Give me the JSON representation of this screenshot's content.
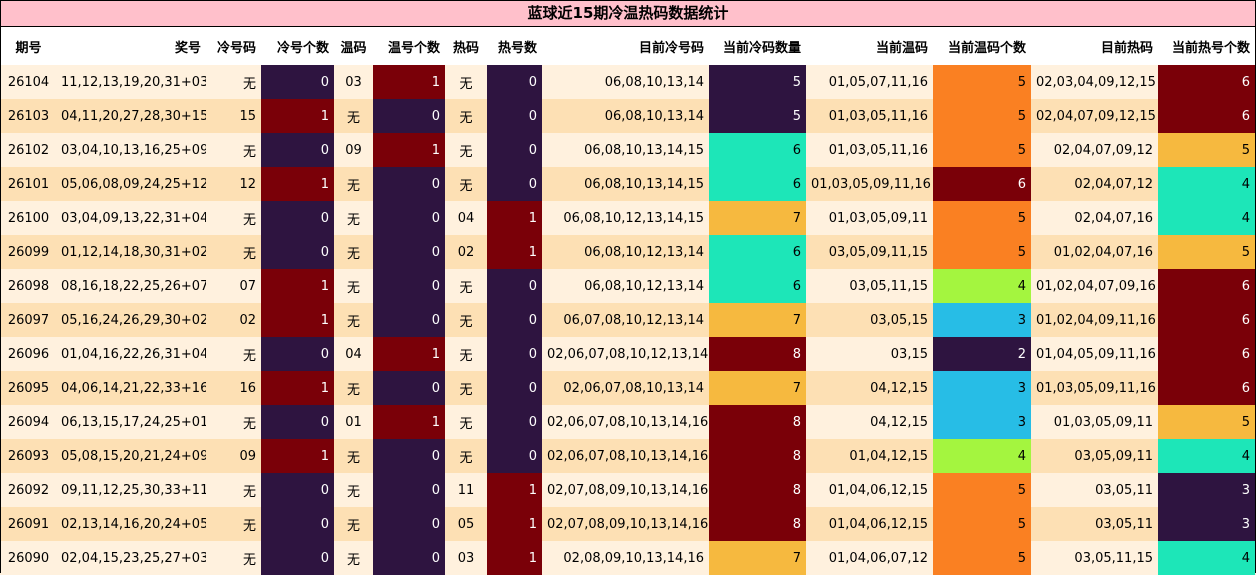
{
  "title": "蓝球近15期冷温热码数据统计",
  "columns": [
    "期号",
    "奖号",
    "冷号码",
    "冷号个数",
    "温码",
    "温号个数",
    "热码",
    "热号数",
    "目前冷号码",
    "当前冷码数量",
    "当前温码",
    "当前温码个数",
    "目前热码",
    "当前热号个数"
  ],
  "rows": [
    [
      "26104",
      "11,12,13,19,20,31+03",
      "无",
      "0",
      "03",
      "1",
      "无",
      "0",
      "06,08,10,13,14",
      "5",
      "01,05,07,11,16",
      "5",
      "02,03,04,09,12,15",
      "6"
    ],
    [
      "26103",
      "04,11,20,27,28,30+15",
      "15",
      "1",
      "无",
      "0",
      "无",
      "0",
      "06,08,10,13,14",
      "5",
      "01,03,05,11,16",
      "5",
      "02,04,07,09,12,15",
      "6"
    ],
    [
      "26102",
      "03,04,10,13,16,25+09",
      "无",
      "0",
      "09",
      "1",
      "无",
      "0",
      "06,08,10,13,14,15",
      "6",
      "01,03,05,11,16",
      "5",
      "02,04,07,09,12",
      "5"
    ],
    [
      "26101",
      "05,06,08,09,24,25+12",
      "12",
      "1",
      "无",
      "0",
      "无",
      "0",
      "06,08,10,13,14,15",
      "6",
      "01,03,05,09,11,16",
      "6",
      "02,04,07,12",
      "4"
    ],
    [
      "26100",
      "03,04,09,13,22,31+04",
      "无",
      "0",
      "无",
      "0",
      "04",
      "1",
      "06,08,10,12,13,14,15",
      "7",
      "01,03,05,09,11",
      "5",
      "02,04,07,16",
      "4"
    ],
    [
      "26099",
      "01,12,14,18,30,31+02",
      "无",
      "0",
      "无",
      "0",
      "02",
      "1",
      "06,08,10,12,13,14",
      "6",
      "03,05,09,11,15",
      "5",
      "01,02,04,07,16",
      "5"
    ],
    [
      "26098",
      "08,16,18,22,25,26+07",
      "07",
      "1",
      "无",
      "0",
      "无",
      "0",
      "06,08,10,12,13,14",
      "6",
      "03,05,11,15",
      "4",
      "01,02,04,07,09,16",
      "6"
    ],
    [
      "26097",
      "05,16,24,26,29,30+02",
      "02",
      "1",
      "无",
      "0",
      "无",
      "0",
      "06,07,08,10,12,13,14",
      "7",
      "03,05,15",
      "3",
      "01,02,04,09,11,16",
      "6"
    ],
    [
      "26096",
      "01,04,16,22,26,31+04",
      "无",
      "0",
      "04",
      "1",
      "无",
      "0",
      "02,06,07,08,10,12,13,14",
      "8",
      "03,15",
      "2",
      "01,04,05,09,11,16",
      "6"
    ],
    [
      "26095",
      "04,06,14,21,22,33+16",
      "16",
      "1",
      "无",
      "0",
      "无",
      "0",
      "02,06,07,08,10,13,14",
      "7",
      "04,12,15",
      "3",
      "01,03,05,09,11,16",
      "6"
    ],
    [
      "26094",
      "06,13,15,17,24,25+01",
      "无",
      "0",
      "01",
      "1",
      "无",
      "0",
      "02,06,07,08,10,13,14,16",
      "8",
      "04,12,15",
      "3",
      "01,03,05,09,11",
      "5"
    ],
    [
      "26093",
      "05,08,15,20,21,24+09",
      "09",
      "1",
      "无",
      "0",
      "无",
      "0",
      "02,06,07,08,10,13,14,16",
      "8",
      "01,04,12,15",
      "4",
      "03,05,09,11",
      "4"
    ],
    [
      "26092",
      "09,11,12,25,30,33+11",
      "无",
      "0",
      "无",
      "0",
      "11",
      "1",
      "02,07,08,09,10,13,14,16",
      "8",
      "01,04,06,12,15",
      "5",
      "03,05,11",
      "3"
    ],
    [
      "26091",
      "02,13,14,16,20,24+05",
      "无",
      "0",
      "无",
      "0",
      "05",
      "1",
      "02,07,08,09,10,13,14,16",
      "8",
      "01,04,06,12,15",
      "5",
      "03,05,11",
      "3"
    ],
    [
      "26090",
      "02,04,15,23,25,27+03",
      "无",
      "0",
      "无",
      "0",
      "03",
      "1",
      "02,08,09,10,13,14,16",
      "7",
      "01,04,06,07,12",
      "5",
      "03,05,11,15",
      "4"
    ]
  ],
  "colors": {
    "title_bg": "#ffc0cb",
    "header_bg": "#ffffff",
    "row_odd_bg": "#fff1de",
    "row_even_bg": "#fde0b4",
    "count_0": "#2e1440",
    "count_1": "#7a0008",
    "count_2": "#2e1440",
    "count_3": "#27bde6",
    "count_4": "#a4f53f",
    "count_5": "#fa8022",
    "count_6": "#1de6b8",
    "count_7": "#f6b93f",
    "count_8": "#7a0008",
    "cur_hot_3": "#2e1440",
    "cur_hot_4": "#1de6b8",
    "cur_hot_5": "#f6b93f",
    "cur_hot_6": "#7a0008",
    "cur_cold_6": "#1de6b8",
    "cur_cold_7": "#f6b93f",
    "cur_cold_8": "#7a0008",
    "cur_cold_5": "#2e1440",
    "cur_warm_2": "#2e1440",
    "cur_warm_3": "#27bde6",
    "cur_warm_4": "#a4f53f",
    "cur_warm_5": "#fa8022",
    "cur_warm_6": "#7a0008"
  }
}
